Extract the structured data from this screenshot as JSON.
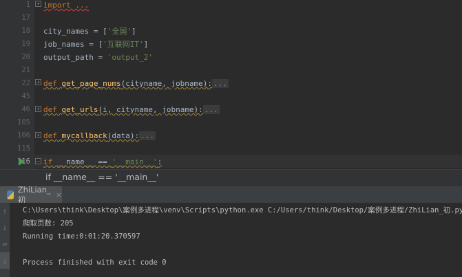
{
  "editor": {
    "line_numbers": [
      "1",
      "17",
      "18",
      "19",
      "20",
      "21",
      "22",
      "45",
      "46",
      "105",
      "106",
      "115",
      "116"
    ],
    "import_line": "import ...",
    "city": {
      "name": "city_names = [",
      "value": "'全国'",
      "end": "]"
    },
    "job": {
      "name": "job_names = [",
      "value": "'互联网IT'",
      "end": "]"
    },
    "output": {
      "name": "output_path = ",
      "value": "'output_2'"
    },
    "def_kw": "def",
    "f1": {
      "name": "get_page_nums",
      "args": "(cityname, jobname):"
    },
    "f2": {
      "name": "get_urls",
      "args": "(i, cityname, jobname):"
    },
    "f3": {
      "name": "mycallback",
      "args": "(data):"
    },
    "collapsed": "...",
    "main": {
      "kw": "if",
      "name": " __name__ == ",
      "value": "'__main__'",
      "end": ":"
    }
  },
  "breadcrumb": "if __name__ == '__main__'",
  "run_tab": {
    "label": "ZhiLian_初",
    "close": "×"
  },
  "side_icons": [
    "↑",
    "↓",
    "⇌",
    "⤓"
  ],
  "console": {
    "lines": [
      "C:\\Users\\think\\Desktop\\案例多进程\\venv\\Scripts\\python.exe C:/Users/think/Desktop/案例多进程/ZhiLian_初.py",
      "爬取页数: 205",
      "Running time:0:01:20.370597",
      "",
      "Process finished with exit code 0"
    ]
  }
}
